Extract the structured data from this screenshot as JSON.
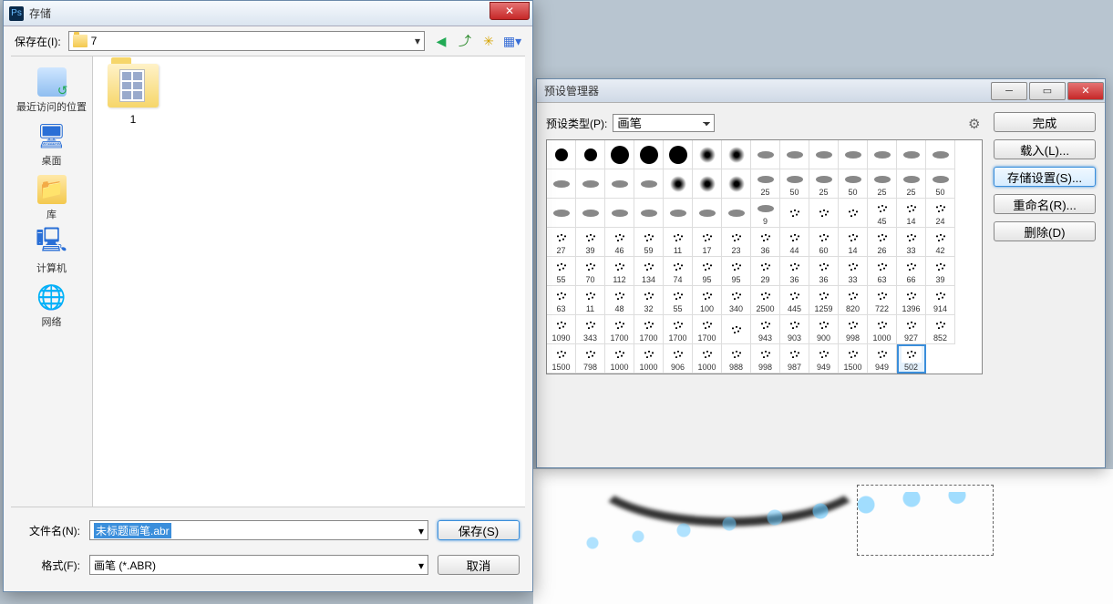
{
  "bg": {},
  "preset": {
    "title": "预设管理器",
    "type_label": "预设类型(P):",
    "type_value": "画笔",
    "buttons": {
      "done": "完成",
      "load": "载入(L)...",
      "save": "存储设置(S)...",
      "rename": "重命名(R)...",
      "delete": "删除(D)"
    },
    "grid_rows": [
      [
        "",
        "",
        "",
        "",
        "",
        "",
        "",
        "",
        "",
        "",
        "",
        "",
        "",
        ""
      ],
      [
        "",
        "",
        "",
        "",
        "",
        "",
        "",
        "25",
        "50",
        "25",
        "50",
        "25",
        "25",
        "50"
      ],
      [
        "",
        "",
        "",
        "",
        "",
        "",
        "",
        "9",
        "",
        "",
        "",
        "45",
        "14",
        "24"
      ],
      [
        "27",
        "39",
        "46",
        "59",
        "11",
        "17",
        "23",
        "36",
        "44",
        "60",
        "14",
        "26",
        "33",
        "42"
      ],
      [
        "55",
        "70",
        "112",
        "134",
        "74",
        "95",
        "95",
        "29",
        "36",
        "36",
        "33",
        "63",
        "66",
        "39"
      ],
      [
        "63",
        "11",
        "48",
        "32",
        "55",
        "100",
        "340",
        "2500",
        "445",
        "1259",
        "820",
        "722",
        "1396",
        "914"
      ],
      [
        "1090",
        "343",
        "1700",
        "1700",
        "1700",
        "1700",
        "",
        "943",
        "903",
        "900",
        "998",
        "1000",
        "927",
        "852"
      ],
      [
        "1500",
        "798",
        "1000",
        "1000",
        "906",
        "1000",
        "988",
        "998",
        "987",
        "949",
        "1500",
        "949",
        "502"
      ]
    ],
    "selected_index": 110
  },
  "save": {
    "title": "存储",
    "save_in_label": "保存在(I):",
    "location": "7",
    "places": {
      "recent": "最近访问的位置",
      "desktop": "桌面",
      "library": "库",
      "computer": "计算机",
      "network": "网络"
    },
    "folder_item": "1",
    "filename_label": "文件名(N):",
    "filename_value": "未标题画笔.abr",
    "format_label": "格式(F):",
    "format_value": "画笔 (*.ABR)",
    "save_btn": "保存(S)",
    "cancel_btn": "取消"
  }
}
